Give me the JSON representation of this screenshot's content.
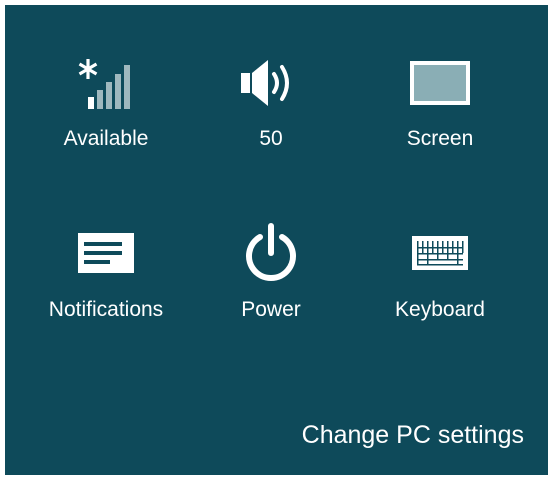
{
  "theme": {
    "background": "#0e4a5a",
    "foreground": "#ffffff",
    "screen_icon_fill": "#8aaeb5"
  },
  "tiles": [
    {
      "label": "Available",
      "icon": "wifi-signal-icon"
    },
    {
      "label": "50",
      "icon": "volume-icon"
    },
    {
      "label": "Screen",
      "icon": "screen-brightness-icon"
    },
    {
      "label": "Notifications",
      "icon": "notifications-icon"
    },
    {
      "label": "Power",
      "icon": "power-icon"
    },
    {
      "label": "Keyboard",
      "icon": "keyboard-icon"
    }
  ],
  "footer": {
    "change_pc_settings": "Change PC settings"
  }
}
